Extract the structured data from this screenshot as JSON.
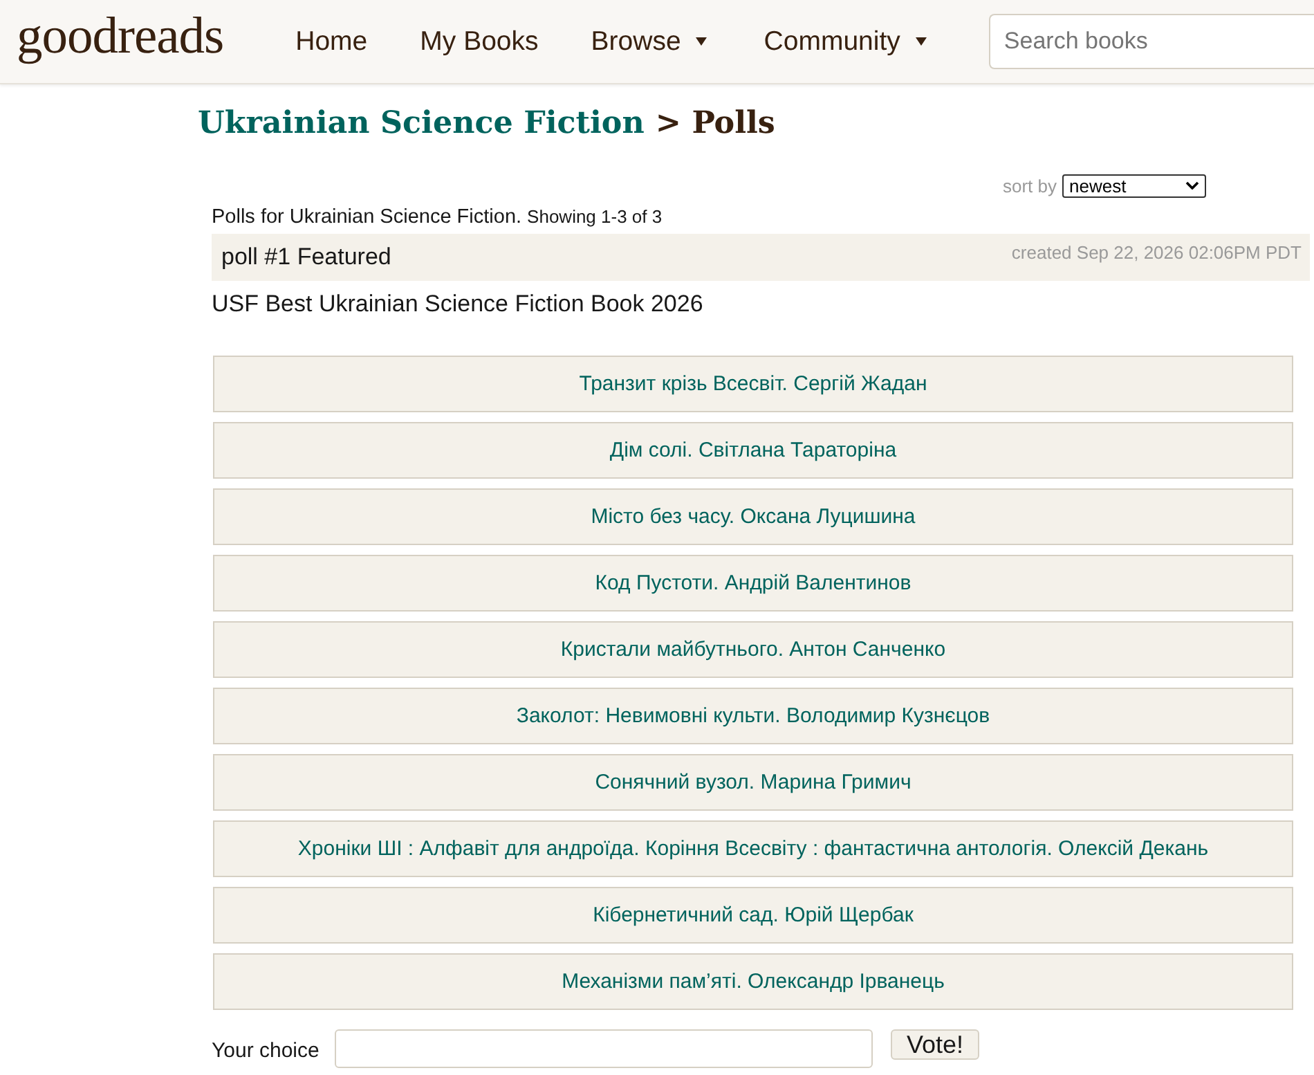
{
  "header": {
    "logo": "goodreads",
    "nav": [
      {
        "label": "Home",
        "dropdown": false
      },
      {
        "label": "My Books",
        "dropdown": false
      },
      {
        "label": "Browse",
        "dropdown": true
      },
      {
        "label": "Community",
        "dropdown": true
      }
    ],
    "search": {
      "placeholder": "Search books"
    }
  },
  "title": {
    "group_link": "Ukrainian Science Fiction",
    "page": "> Polls"
  },
  "sort": {
    "label": "sort by",
    "value": "newest"
  },
  "summary": {
    "text": "Polls for Ukrainian Science Fiction.",
    "count": "Showing 1-3 of 3"
  },
  "poll": {
    "heading": "poll #1 Featured",
    "created": "created Sep 22, 2026 02:06PM PDT",
    "question": "USF Best Ukrainian Science Fiction Book 2026",
    "answers": [
      "Транзит крізь Всесвіт. Сергій Жадан",
      "Дім солі. Світлана Тараторіна",
      "Місто без часу. Оксана Луцишина",
      "Код Пустоти. Андрій Валентинов",
      "Кристали майбутнього. Антон Санченко",
      "Заколот: Невимовні культи. Володимир Кузнєцов",
      "Сонячний вузол. Марина Гримич",
      "Хроніки ШІ : Алфавіт для андроїда. Коріння Всесвіту : фантастична антологія. Олексій Декань",
      "Кібернетичний сад. Юрій Щербак",
      "Механізми пам’яті. Олександр Ірванець"
    ],
    "choice": {
      "label": "Your choice",
      "button": "Vote!"
    }
  }
}
